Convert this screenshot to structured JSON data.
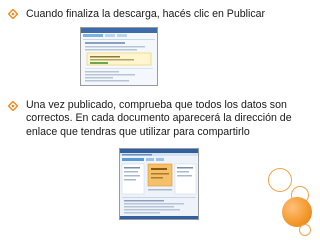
{
  "bullets": [
    {
      "text": "Cuando finaliza la descarga, hacés clic en Publicar"
    },
    {
      "text": "Una vez publicado, comprueba que todos los datos son correctos. En cada documento  aparecerá la dirección de enlace que tendras que utilizar para compartirlo"
    }
  ],
  "colors": {
    "accent": "#f08a1c",
    "text": "#1a1a1a",
    "background": "#ffffff"
  },
  "icons": {
    "bullet": "diamond-bullet-icon"
  }
}
